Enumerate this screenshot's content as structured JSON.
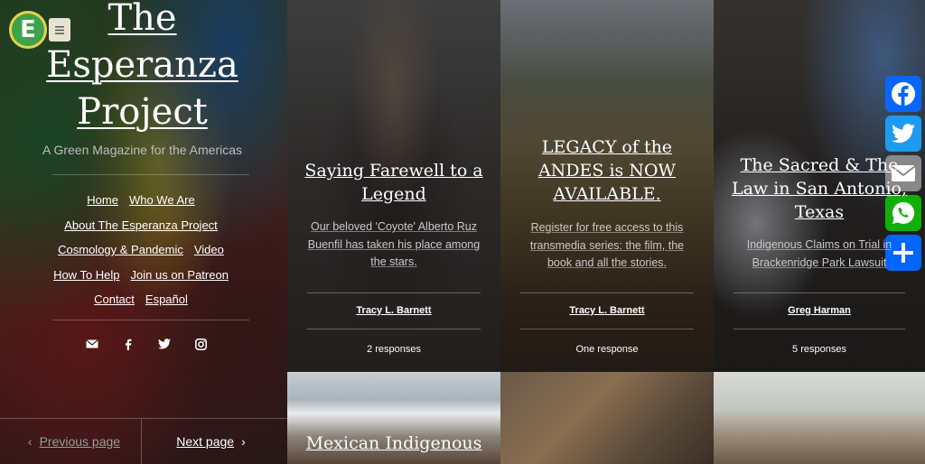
{
  "sidebar": {
    "logo_letter": "E",
    "menu_icon": "menu-icon",
    "title": "The Esperanza Project",
    "tagline": "A Green Magazine for the Americas",
    "nav_rows": [
      [
        "Home",
        "Who We Are"
      ],
      [
        "About The Esperanza Project"
      ],
      [
        "Cosmology & Pandemic",
        "Video"
      ],
      [
        "How To Help",
        "Join us on Patreon"
      ],
      [
        "Contact",
        "Español"
      ]
    ],
    "social": [
      "mail-icon",
      "facebook-icon",
      "twitter-icon",
      "instagram-icon"
    ],
    "prev_label": "Previous page",
    "next_label": "Next page"
  },
  "cards": [
    {
      "title": "Saying Farewell to a Legend",
      "excerpt": "Our beloved 'Coyote' Alberto Ruz Buenfil has taken his place among the stars.",
      "author": "Tracy L. Barnett",
      "responses": "2 responses"
    },
    {
      "title": "LEGACY of the ANDES is NOW AVAILABLE.",
      "excerpt": "Register for free access to this transmedia series: the film, the book and all the stories.",
      "author": "Tracy L. Barnett",
      "responses": "One response"
    },
    {
      "title": "The Sacred & The Law in San Antonio, Texas",
      "excerpt": "Indigenous Claims on Trial in Brackenridge Park Lawsuit",
      "author": "Greg Harman",
      "responses": "5 responses"
    }
  ],
  "bottom": {
    "title": "Mexican Indigenous"
  },
  "share": [
    {
      "icon": "facebook-icon",
      "color": "#0866ff"
    },
    {
      "icon": "twitter-icon",
      "color": "#1d9bf0"
    },
    {
      "icon": "email-icon",
      "color": "#888888"
    },
    {
      "icon": "whatsapp-icon",
      "color": "#12af0a"
    },
    {
      "icon": "share-plus-icon",
      "color": "#0166ff"
    }
  ]
}
